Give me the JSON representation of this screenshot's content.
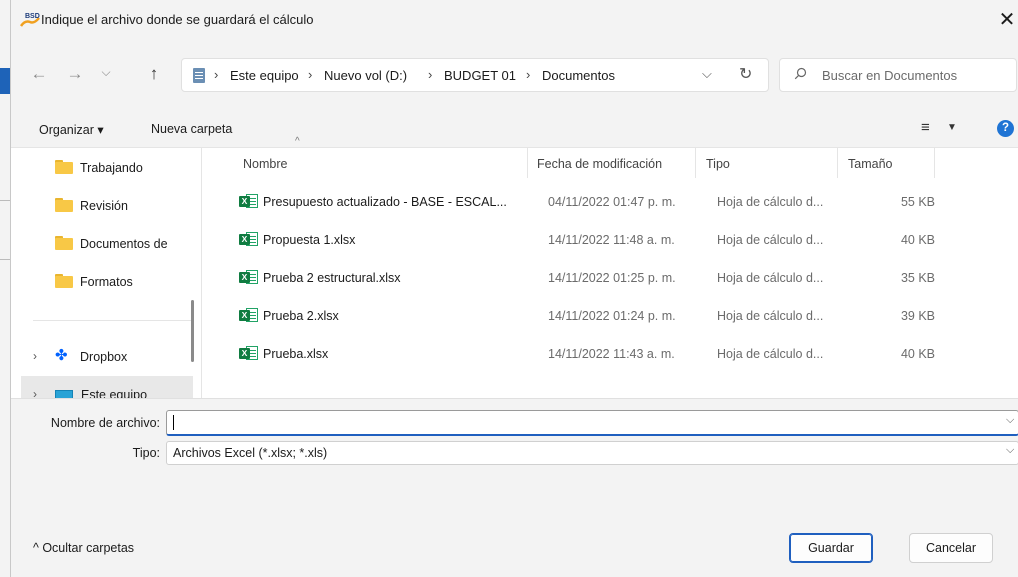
{
  "window": {
    "title": "Indique el archivo donde se guardará el cálculo",
    "app_icon_text": "BSD",
    "close_glyph": "✕"
  },
  "navigation": {
    "back_glyph": "←",
    "forward_glyph": "→",
    "recent_glyph": "⌵",
    "up_glyph": "↑",
    "breadcrumb": [
      "Este equipo",
      "Nuevo vol (D:)",
      "BUDGET 01",
      "Documentos"
    ],
    "breadcrumb_sep": "›",
    "dropdown_glyph": "⌵",
    "refresh_glyph": "↻"
  },
  "search": {
    "placeholder": "Buscar en Documentos"
  },
  "commandbar": {
    "organize_label": "Organizar ▾",
    "new_folder_label": "Nueva carpeta",
    "view_glyph": "≡",
    "view_caret": "▼",
    "help_glyph": "?"
  },
  "sidebar": {
    "items": [
      {
        "label": "Trabajando"
      },
      {
        "label": "Revisión"
      },
      {
        "label": "Documentos de"
      },
      {
        "label": "Formatos"
      }
    ],
    "dropbox_label": "Dropbox",
    "dropbox_glyph": "✤",
    "this_pc_label": "Este equipo",
    "expander_glyph": "›"
  },
  "file_list": {
    "columns": {
      "name": "Nombre",
      "date": "Fecha de modificación",
      "type": "Tipo",
      "size": "Tamaño"
    },
    "sort_glyph": "^",
    "rows": [
      {
        "name": "Presupuesto actualizado - BASE - ESCAL...",
        "date": "04/11/2022 01:47 p. m.",
        "type": "Hoja de cálculo d...",
        "size": "55 KB"
      },
      {
        "name": "Propuesta 1.xlsx",
        "date": "14/11/2022 11:48 a. m.",
        "type": "Hoja de cálculo d...",
        "size": "40 KB"
      },
      {
        "name": "Prueba 2 estructural.xlsx",
        "date": "14/11/2022 01:25 p. m.",
        "type": "Hoja de cálculo d...",
        "size": "35 KB"
      },
      {
        "name": "Prueba 2.xlsx",
        "date": "14/11/2022 01:24 p. m.",
        "type": "Hoja de cálculo d...",
        "size": "39 KB"
      },
      {
        "name": "Prueba.xlsx",
        "date": "14/11/2022 11:43 a. m.",
        "type": "Hoja de cálculo d...",
        "size": "40 KB"
      }
    ]
  },
  "save_panel": {
    "filename_label": "Nombre de archivo:",
    "filename_value": "",
    "type_label": "Tipo:",
    "type_value": "Archivos Excel (*.xlsx; *.xls)",
    "chevron_glyph": "⌵",
    "hide_folders_label": "^  Ocultar carpetas",
    "save_label": "Guardar",
    "cancel_label": "Cancelar"
  },
  "colors": {
    "accent": "#1f5fbf",
    "chrome": "#f3f3f3",
    "excel_green": "#107c41",
    "folder_yellow": "#f8c846"
  }
}
